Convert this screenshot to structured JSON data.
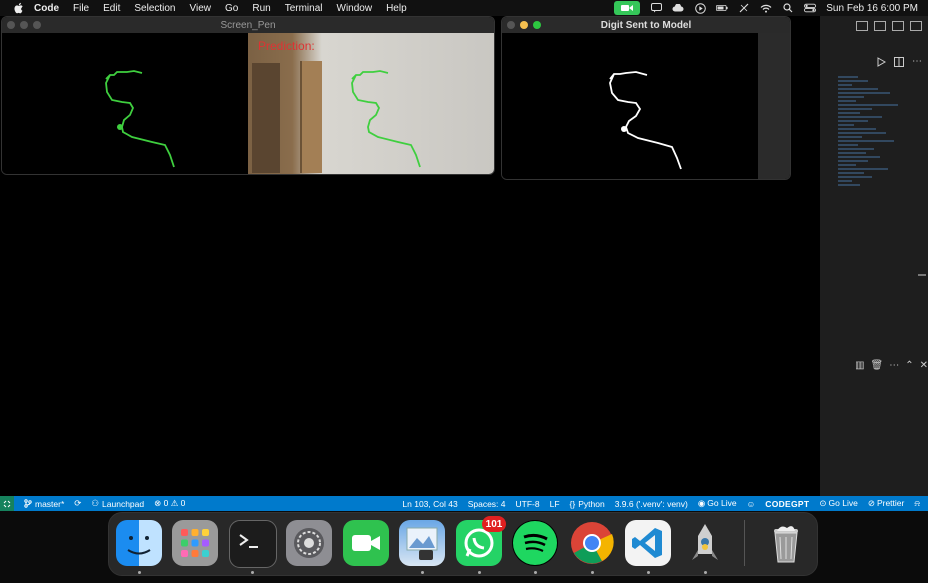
{
  "menubar": {
    "app_name": "Code",
    "items": [
      "File",
      "Edit",
      "Selection",
      "View",
      "Go",
      "Run",
      "Terminal",
      "Window",
      "Help"
    ],
    "datetime": "Sun Feb 16  6:00 PM"
  },
  "windows": {
    "screen_pen": {
      "title": "Screen_Pen",
      "prediction_label": "Prediction:"
    },
    "digit": {
      "title": "Digit Sent to Model"
    }
  },
  "statusbar": {
    "branch": "master*",
    "launchpad": "Launchpad",
    "problems": "⊗ 0 ⚠ 0",
    "position": "Ln 103, Col 43",
    "spaces": "Spaces: 4",
    "encoding": "UTF-8",
    "eol": "LF",
    "language": "Python",
    "interpreter": "3.9.6 ('.venv': venv)",
    "golive1": "Go Live",
    "codegpt": "CODEGPT",
    "golive2": "Go Live",
    "prettier": "Prettier"
  },
  "dock": {
    "whatsapp_badge": "101"
  },
  "colors": {
    "statusbar": "#007acc",
    "stroke_green": "#3fcf3f",
    "prediction_red": "#d33333"
  }
}
